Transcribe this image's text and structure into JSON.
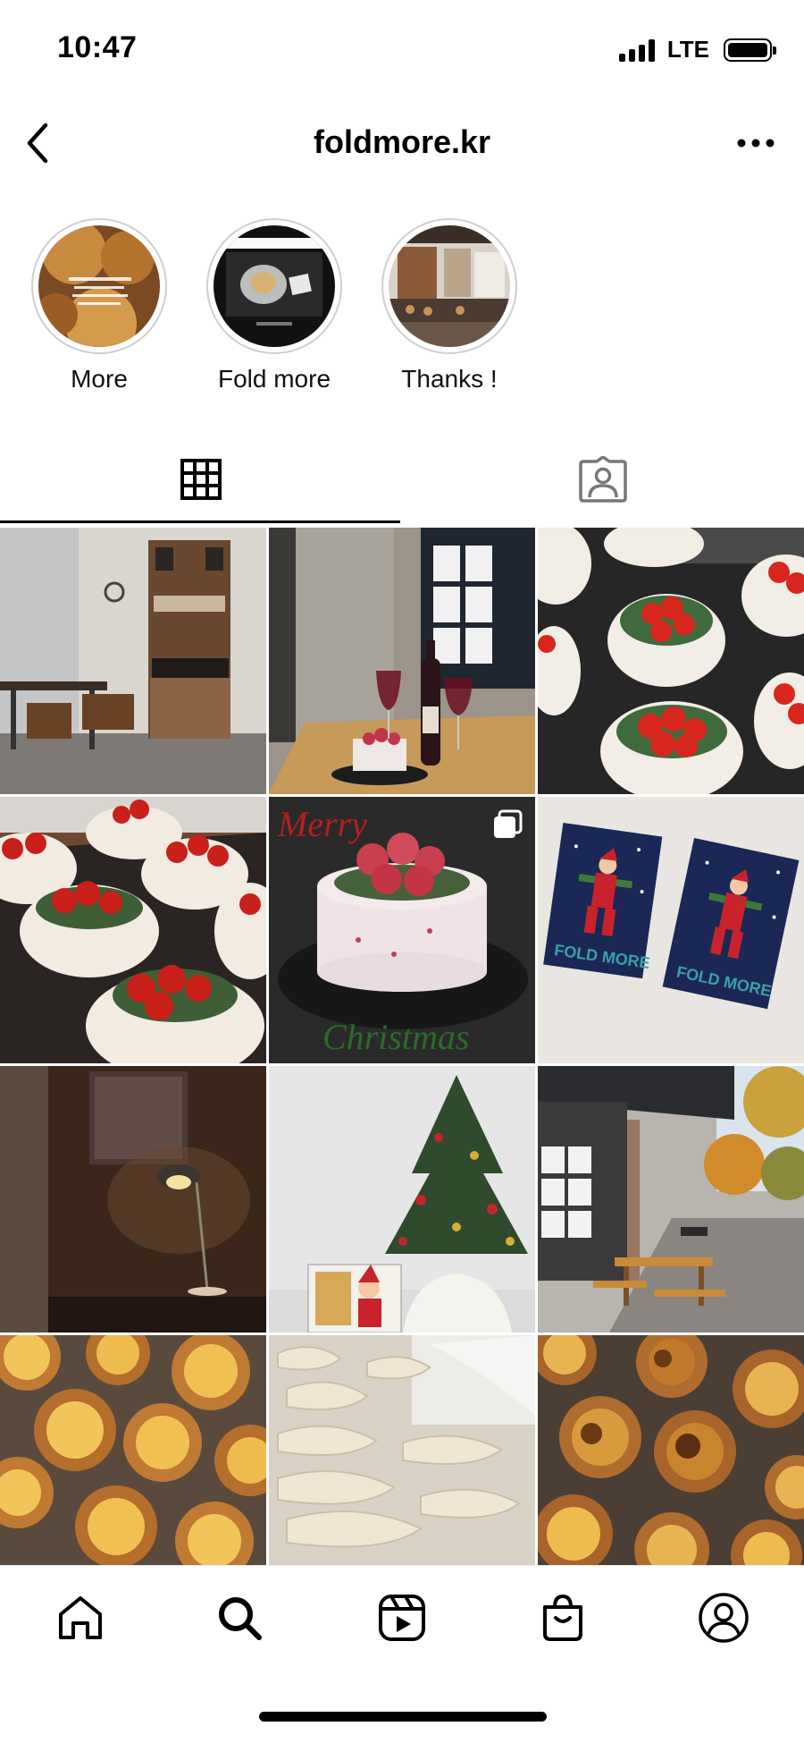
{
  "status_bar": {
    "time": "10:47",
    "network": "LTE",
    "battery_level": 0.95
  },
  "header": {
    "username": "foldmore.kr",
    "back_icon": "chevron-left-icon",
    "menu_icon": "more-horizontal-icon"
  },
  "highlights": [
    {
      "label": "More"
    },
    {
      "label": "Fold more"
    },
    {
      "label": "Thanks !"
    }
  ],
  "tabs": [
    {
      "name": "posts-grid",
      "icon": "grid-icon",
      "active": true
    },
    {
      "name": "tagged",
      "icon": "tagged-person-icon",
      "active": false
    }
  ],
  "posts": [
    {
      "subject": "cafe interior with shelf and speakers"
    },
    {
      "subject": "cake and red wine on table"
    },
    {
      "subject": "strawberry cakes on black tray"
    },
    {
      "subject": "strawberry cakes close-up"
    },
    {
      "subject": "strawberry christmas cake",
      "overlay_top": "Merry",
      "overlay_bottom": "Christmas",
      "carousel": true
    },
    {
      "subject": "fold more santa posters",
      "poster_text": "FOLD MORE"
    },
    {
      "subject": "dark room with lamp"
    },
    {
      "subject": "christmas tree with records"
    },
    {
      "subject": "storefront with benches"
    },
    {
      "subject": "egg tarts"
    },
    {
      "subject": "croissant dough"
    },
    {
      "subject": "egg tarts close-up"
    }
  ],
  "bottom_nav": [
    {
      "name": "home",
      "icon": "home-icon"
    },
    {
      "name": "search",
      "icon": "search-icon",
      "active": true
    },
    {
      "name": "reels",
      "icon": "reels-icon"
    },
    {
      "name": "shop",
      "icon": "shop-bag-icon"
    },
    {
      "name": "profile",
      "icon": "profile-icon"
    }
  ],
  "colors": {
    "background": "#ffffff",
    "text": "#000000",
    "divider": "#efefef",
    "highlight_ring": "#cfcfcf"
  }
}
